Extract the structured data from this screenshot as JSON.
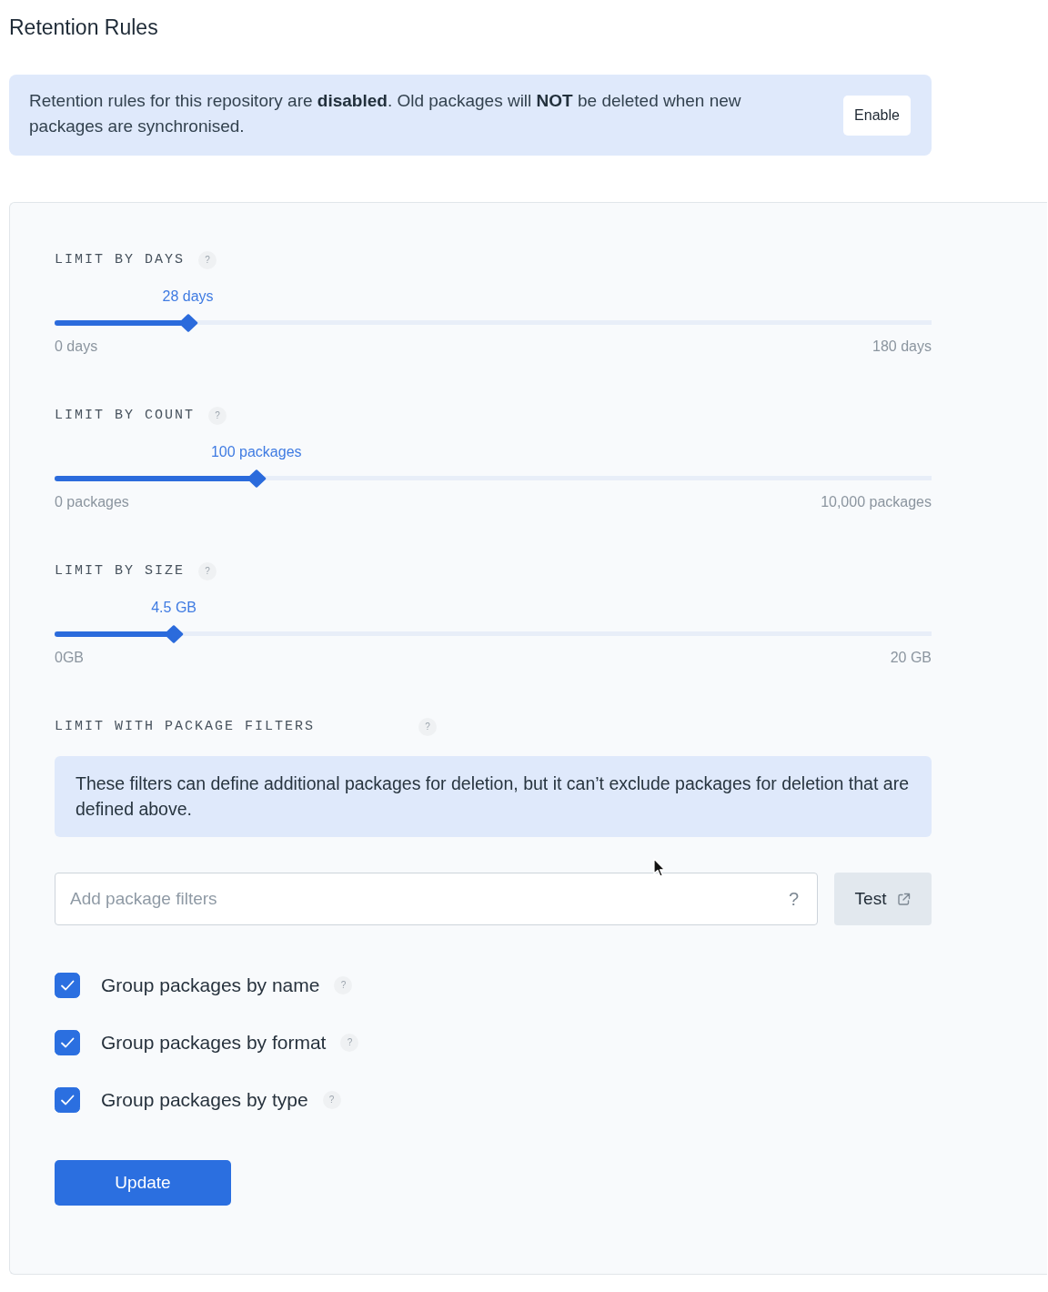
{
  "page": {
    "title": "Retention Rules"
  },
  "banner": {
    "text": "Retention rules for this repository are **disabled**. Old packages will **NOT** be deleted when new packages are synchronised.",
    "button": "Enable"
  },
  "limits": [
    {
      "label": "LIMIT BY DAYS",
      "help": "?",
      "value": "28 days",
      "level": 0.152,
      "min": "0 days",
      "max": "180 days"
    },
    {
      "label": "LIMIT BY COUNT",
      "help": "?",
      "value": "100 packages",
      "level": 0.23,
      "min": "0 packages",
      "max": "10,000 packages"
    },
    {
      "label": "LIMIT BY SIZE",
      "help": "?",
      "value": "4.5 GB",
      "level": 0.136,
      "min": "0GB",
      "max": "20 GB"
    }
  ],
  "filters": {
    "label": "LIMIT WITH PACKAGE FILTERS",
    "help": "?",
    "note": "These filters can define additional packages for deletion, but it can’t exclude packages for deletion that are defined above.",
    "input": {
      "placeholder": "Add package filters",
      "help": "?"
    },
    "test_button": "Test"
  },
  "options": [
    {
      "label": "Group packages by name",
      "checked": true,
      "help": "?"
    },
    {
      "label": "Group packages by format",
      "checked": true,
      "help": "?"
    },
    {
      "label": "Group packages by type",
      "checked": true,
      "help": "?"
    }
  ],
  "submit_button": "Update"
}
